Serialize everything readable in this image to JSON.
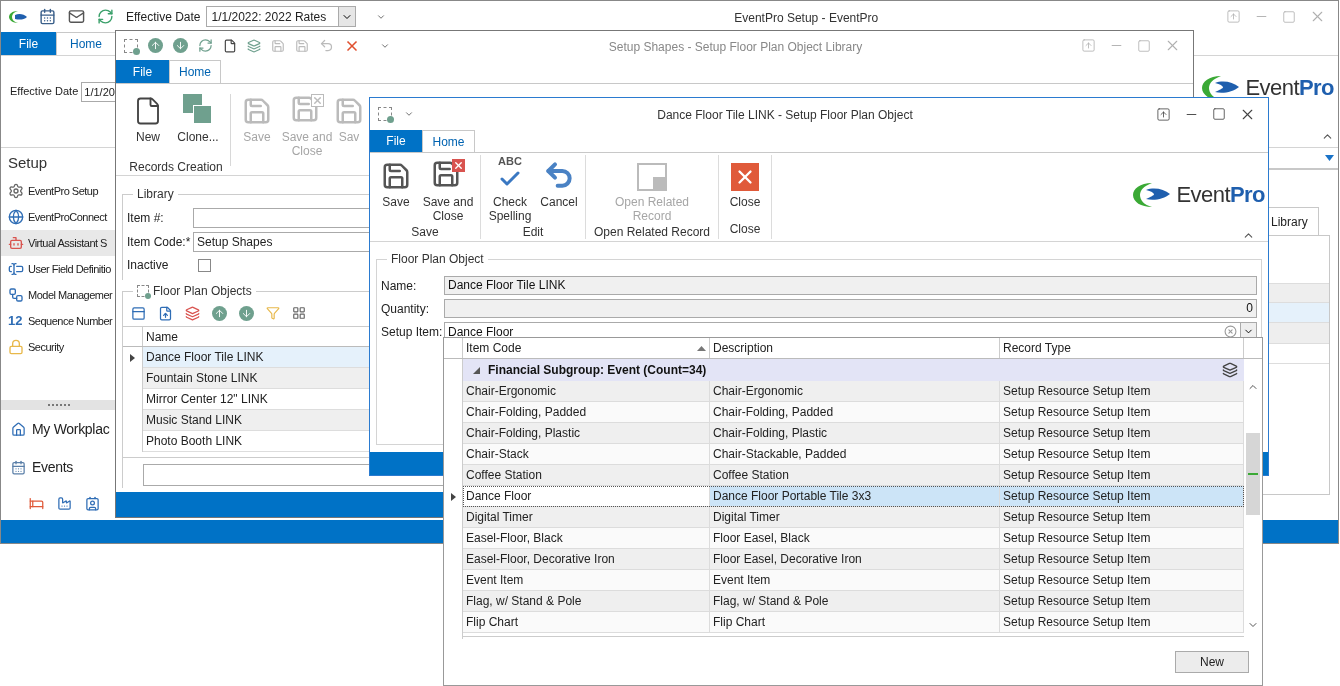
{
  "main_window": {
    "title": "EventPro Setup - EventPro",
    "effective_date_label": "Effective Date",
    "effective_date_value": "1/1/2022: 2022 Rates",
    "tabs": [
      {
        "label": "File",
        "selected": false
      },
      {
        "label": "Home",
        "selected": true
      }
    ],
    "ribbon": {
      "effective_date_label": "Effective Date",
      "effective_date_value": "1/1/20",
      "logo": {
        "prefix": "Event",
        "suffix": "Pro"
      }
    },
    "sidebar": {
      "title": "Setup",
      "items": [
        {
          "label": "EventPro Setup",
          "selected": false
        },
        {
          "label": "EventProConnect",
          "selected": false
        },
        {
          "label": "Virtual Assistant S",
          "selected": true
        },
        {
          "label": "User Field Definitio",
          "selected": false
        },
        {
          "label": "Model Managemer",
          "selected": false
        },
        {
          "label": "Sequence Number",
          "glyph": "12",
          "selected": false
        },
        {
          "label": "Security",
          "selected": false
        }
      ],
      "nav": [
        {
          "label": "My Workplac"
        },
        {
          "label": "Events"
        }
      ]
    },
    "library_tab": "Library"
  },
  "middle_window": {
    "title": "Setup Shapes - Setup Floor Plan Object Library",
    "tabs": [
      {
        "label": "File",
        "selected": false
      },
      {
        "label": "Home",
        "selected": true
      }
    ],
    "ribbon": {
      "group_label": "Records Creation",
      "buttons": [
        {
          "label": "New",
          "disabled": false
        },
        {
          "label": "Clone...",
          "disabled": false
        },
        {
          "label": "Save",
          "disabled": true
        },
        {
          "label": "Save and Close",
          "disabled": true
        },
        {
          "label": "Sav",
          "disabled": true
        }
      ]
    },
    "library": {
      "legend": "Library",
      "item_number_label": "Item #:",
      "item_code_label": "Item Code:*",
      "item_code_value": "Setup Shapes",
      "inactive_label": "Inactive",
      "inactive_checked": false
    },
    "floor_plan_objects": {
      "legend": "Floor Plan Objects",
      "column": "Name",
      "rows": [
        {
          "name": "Dance Floor Tile LINK",
          "selected": true
        },
        {
          "name": "Fountain Stone LINK",
          "selected": false
        },
        {
          "name": "Mirror Center 12\" LINK",
          "selected": false
        },
        {
          "name": "Music Stand LINK",
          "selected": false
        },
        {
          "name": "Photo Booth LINK",
          "selected": false
        }
      ]
    }
  },
  "front_window": {
    "title": "Dance Floor Tile LINK - Setup Floor Plan Object",
    "tabs": [
      {
        "label": "File",
        "selected": false
      },
      {
        "label": "Home",
        "selected": true
      }
    ],
    "ribbon_groups": [
      {
        "label": "Save",
        "buttons": [
          {
            "label": "Save",
            "disabled": false
          },
          {
            "label": "Save and Close",
            "disabled": false
          }
        ]
      },
      {
        "label": "Edit",
        "buttons": [
          {
            "label": "Check Spelling",
            "glyph": "ABC",
            "disabled": false
          },
          {
            "label": "Cancel",
            "disabled": false
          }
        ]
      },
      {
        "label": "Open Related Record",
        "buttons": [
          {
            "label": "Open Related Record",
            "disabled": true
          }
        ]
      },
      {
        "label": "Close",
        "buttons": [
          {
            "label": "Close",
            "disabled": false
          }
        ]
      }
    ],
    "logo": {
      "prefix": "Event",
      "suffix": "Pro"
    },
    "form": {
      "legend": "Floor Plan Object",
      "name_label": "Name:",
      "name_value": "Dance Floor Tile LINK",
      "quantity_label": "Quantity:",
      "quantity_value": "0",
      "setup_item_label": "Setup Item:",
      "setup_item_value": "Dance Floor"
    },
    "lookup": {
      "columns": [
        {
          "label": "Item Code",
          "sorted": true
        },
        {
          "label": "Description",
          "sorted": false
        },
        {
          "label": "Record Type",
          "sorted": false
        }
      ],
      "group_row": {
        "label": "Financial Subgroup: Event (Count=34)",
        "expanded": true
      },
      "rows": [
        {
          "item_code": "Chair-Ergonomic",
          "description": "Chair-Ergonomic",
          "record_type": "Setup Resource Setup Item",
          "selected": false
        },
        {
          "item_code": "Chair-Folding, Padded",
          "description": "Chair-Folding, Padded",
          "record_type": "Setup Resource Setup Item",
          "selected": false
        },
        {
          "item_code": "Chair-Folding, Plastic",
          "description": "Chair-Folding, Plastic",
          "record_type": "Setup Resource Setup Item",
          "selected": false
        },
        {
          "item_code": "Chair-Stack",
          "description": "Chair-Stackable, Padded",
          "record_type": "Setup Resource Setup Item",
          "selected": false
        },
        {
          "item_code": "Coffee Station",
          "description": "Coffee Station",
          "record_type": "Setup Resource Setup Item",
          "selected": false
        },
        {
          "item_code": "Dance Floor",
          "description": "Dance Floor Portable Tile 3x3",
          "record_type": "Setup Resource Setup Item",
          "selected": true
        },
        {
          "item_code": "Digital Timer",
          "description": "Digital Timer",
          "record_type": "Setup Resource Setup Item",
          "selected": false
        },
        {
          "item_code": "Easel-Floor, Black",
          "description": "Floor Easel, Black",
          "record_type": "Setup Resource Setup Item",
          "selected": false
        },
        {
          "item_code": "Easel-Floor, Decorative Iron",
          "description": "Floor Easel, Decorative Iron",
          "record_type": "Setup Resource Setup Item",
          "selected": false
        },
        {
          "item_code": "Event Item",
          "description": "Event Item",
          "record_type": "Setup Resource Setup Item",
          "selected": false
        },
        {
          "item_code": "Flag, w/ Stand & Pole",
          "description": "Flag, w/ Stand & Pole",
          "record_type": "Setup Resource Setup Item",
          "selected": false
        },
        {
          "item_code": "Flip Chart",
          "description": "Flip Chart",
          "record_type": "Setup Resource Setup Item",
          "selected": false
        }
      ],
      "new_button": "New"
    }
  }
}
